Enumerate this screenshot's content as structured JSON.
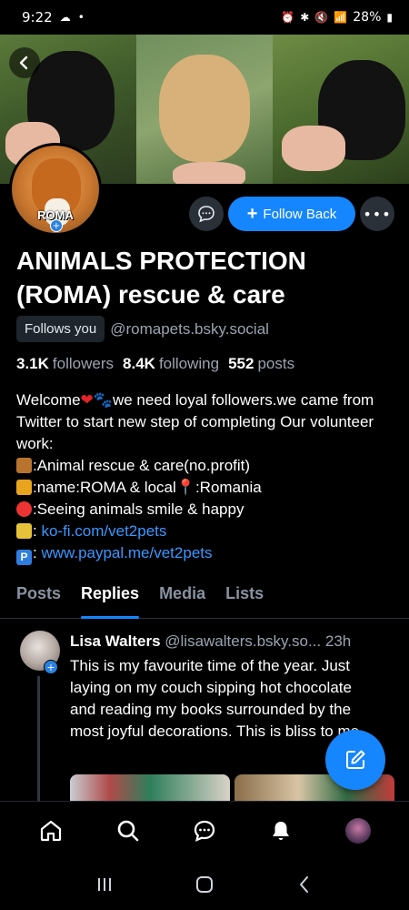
{
  "status_bar": {
    "time": "9:22",
    "battery": "28%"
  },
  "profile": {
    "avatar_label": "ROMA",
    "display_name": "ANIMALS PROTECTION (ROMA) rescue & care",
    "follows_you": "Follows you",
    "handle": "@romapets.bsky.social",
    "followers_count": "3.1K",
    "followers_label": "followers",
    "following_count": "8.4K",
    "following_label": "following",
    "posts_count": "552",
    "posts_label": "posts",
    "follow_back_label": "Follow Back",
    "bio": {
      "line1a": "Welcome",
      "line1b": "we need loyal followers.we came from Twitter to start new step of completing Our volunteer work:",
      "line2": ":Animal rescue & care(no.profit)",
      "line3a": ":name:ROMA & local",
      "line3b": ":Romania",
      "line4": ":Seeing animals smile & happy",
      "line5_link": "ko-fi.com/vet2pets",
      "line6_link": "www.paypal.me/vet2pets"
    }
  },
  "tabs": [
    {
      "label": "Posts"
    },
    {
      "label": "Replies"
    },
    {
      "label": "Media"
    },
    {
      "label": "Lists"
    }
  ],
  "post": {
    "author": "Lisa Walters",
    "handle": "@lisawalters.bsky.so...",
    "time": "23h",
    "text": "This is my favourite time of the year. Just laying on my couch sipping hot chocolate and reading my books surrounded by the most joyful decorations. This is bliss to me."
  },
  "colors": {
    "accent": "#1686fe",
    "background": "#000000",
    "link": "#3a97ff"
  }
}
